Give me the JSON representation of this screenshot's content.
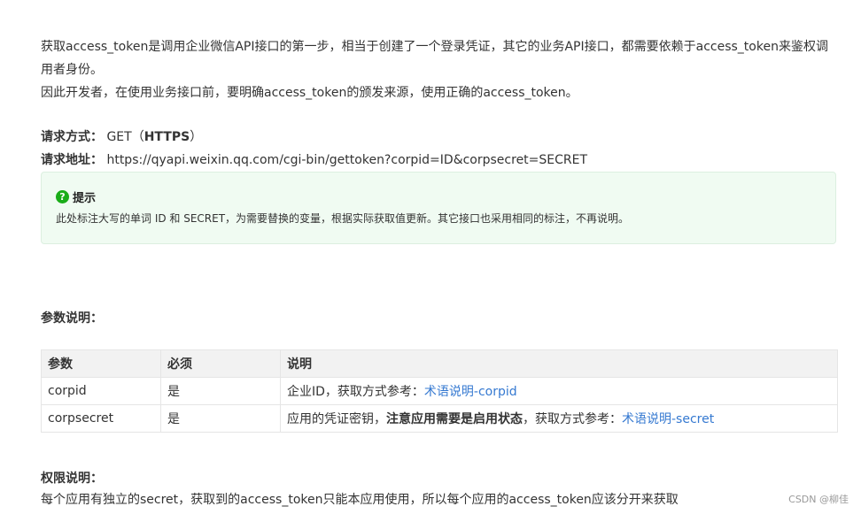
{
  "intro": {
    "line1": "获取access_token是调用企业微信API接口的第一步，相当于创建了一个登录凭证，其它的业务API接口，都需要依赖于access_token来鉴权调用者身份。",
    "line2": "因此开发者，在使用业务接口前，要明确access_token的颁发来源，使用正确的access_token。"
  },
  "request": {
    "method_label": "请求方式：",
    "method_value": "GET（",
    "method_bold": "HTTPS",
    "method_close": "）",
    "url_label": "请求地址：",
    "url_value": "https://qyapi.weixin.qq.com/cgi-bin/gettoken?corpid=ID&corpsecret=SECRET"
  },
  "tip": {
    "icon": "question-circle-icon",
    "title": "提示",
    "body": "此处标注大写的单词 ID 和 SECRET，为需要替换的变量，根据实际获取值更新。其它接口也采用相同的标注，不再说明。"
  },
  "params": {
    "title": "参数说明：",
    "headers": [
      "参数",
      "必须",
      "说明"
    ],
    "rows": [
      {
        "name": "corpid",
        "required": "是",
        "desc_prefix": "企业ID，获取方式参考：",
        "desc_bold": "",
        "desc_mid": "",
        "link": "术语说明-corpid"
      },
      {
        "name": "corpsecret",
        "required": "是",
        "desc_prefix": "应用的凭证密钥，",
        "desc_bold": "注意应用需要是启用状态",
        "desc_mid": "，获取方式参考：",
        "link": "术语说明-secret"
      }
    ]
  },
  "permission": {
    "title": "权限说明：",
    "body": "每个应用有独立的secret，获取到的access_token只能本应用使用，所以每个应用的access_token应该分开来获取"
  },
  "watermark": "CSDN @柳佳",
  "colors": {
    "link": "#3579d1",
    "tip_bg": "#f0fbf2",
    "tip_icon": "#1aad19",
    "table_header_bg": "#f2f2f2"
  }
}
